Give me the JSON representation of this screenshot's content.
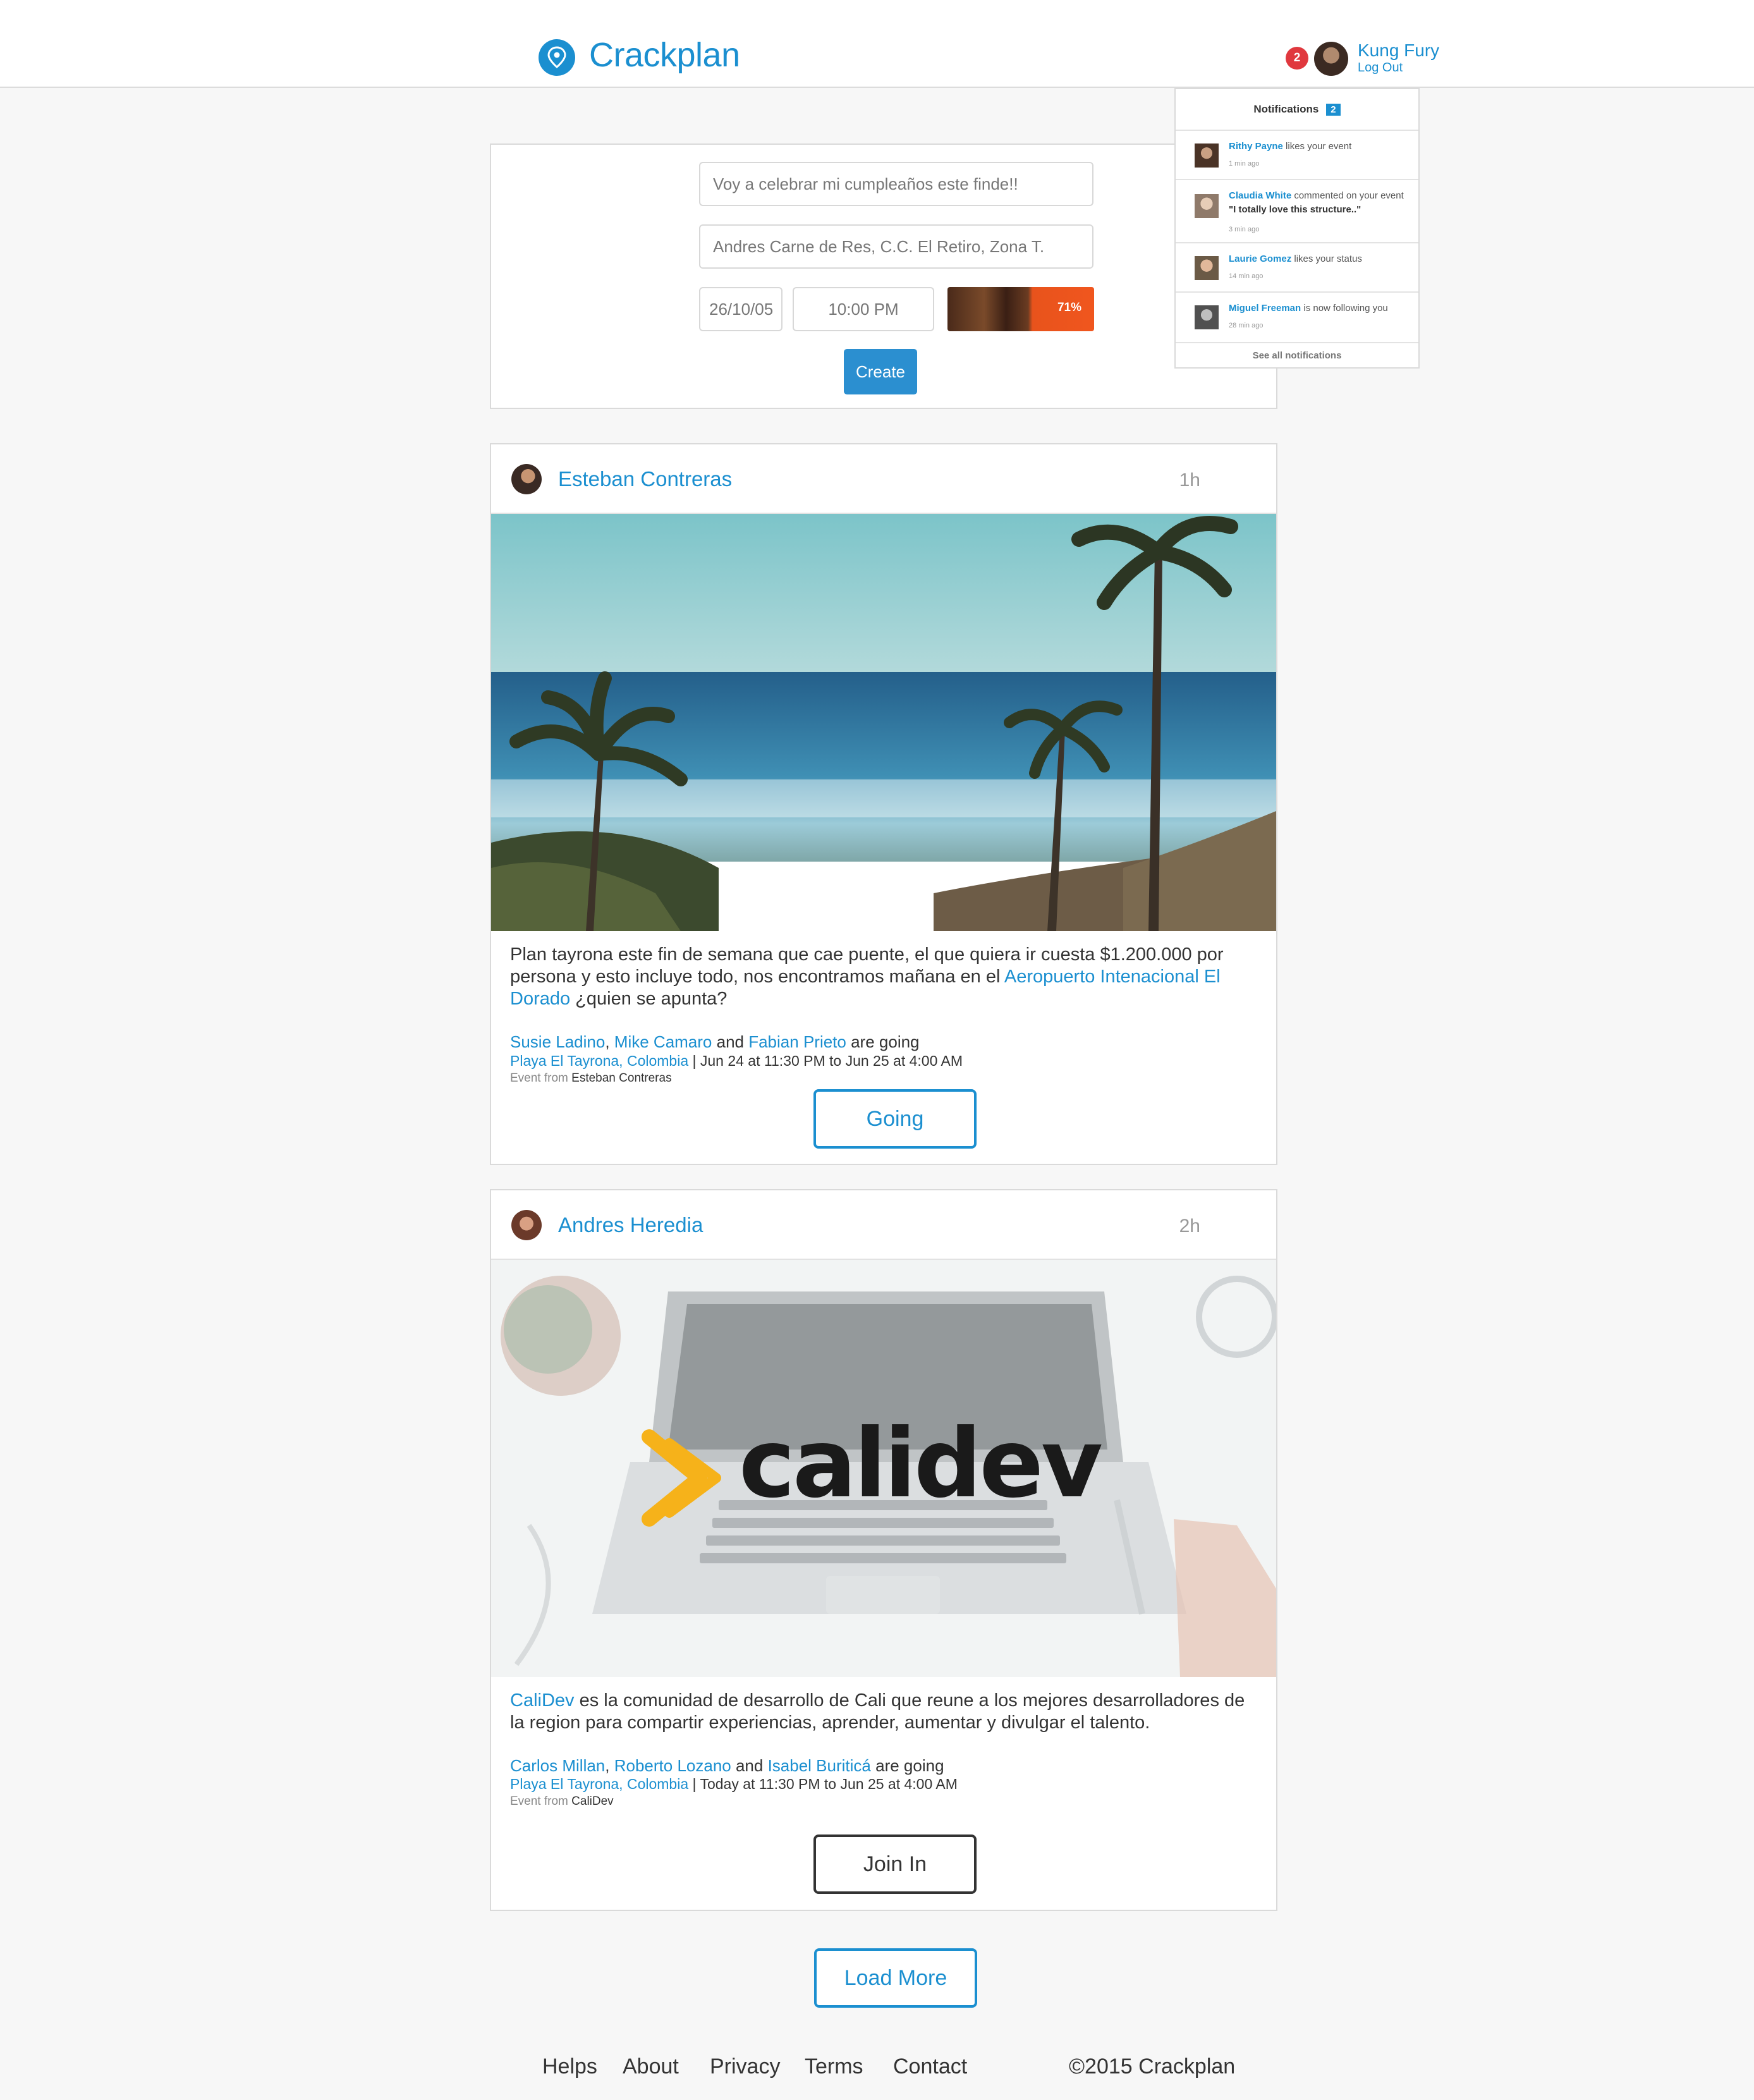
{
  "header": {
    "brand": "Crackplan",
    "notification_count": "2",
    "user_name": "Kung Fury",
    "logout_label": "Log Out"
  },
  "notifications": {
    "title": "Notifications",
    "count": "2",
    "items": [
      {
        "who": "Rithy Payne",
        "text": " likes your event",
        "quote": "",
        "ago": "1 min ago"
      },
      {
        "who": "Claudia White",
        "text": " commented on your event ",
        "quote": "\"I totally love this structure..\"",
        "ago": "3 min ago"
      },
      {
        "who": "Laurie Gomez",
        "text": " likes your status",
        "quote": "",
        "ago": "14 min ago"
      },
      {
        "who": "Miguel Freeman",
        "text": " is now following you",
        "quote": "",
        "ago": "28 min ago"
      }
    ],
    "see_all": "See all notifications"
  },
  "create": {
    "title_value": "Voy a celebrar mi cumpleaños este finde!!",
    "place_value": "Andres Carne de Res, C.C. El Retiro, Zona T.",
    "date_value": "26/10/05",
    "time_value": "10:00 PM",
    "upload_progress": "71%",
    "create_label": "Create"
  },
  "posts": [
    {
      "author": "Esteban Contreras",
      "time": "1h",
      "text_before": "Plan tayrona este fin de semana que cae puente, el que quiera ir cuesta $1.200.000 por persona y esto incluye todo, nos encontramos mañana en el ",
      "text_link": "Aeropuerto Intenacional El Dorado",
      "text_after": " ¿quien se apunta?",
      "going": [
        "Susie Ladino",
        "Mike Camaro",
        "Fabian Prieto"
      ],
      "sep": ", ",
      "and": " and ",
      "going_suffix": " are going",
      "place": "Playa El Tayrona, Colombia",
      "when": " | Jun 24 at 11:30 PM to Jun 25 at 4:00 AM",
      "event_from_label": "Event from ",
      "event_from": "Esteban Contreras",
      "action": "Going"
    },
    {
      "author": "Andres Heredia",
      "time": "2h",
      "image_logo": "calidev",
      "text_link": "CaliDev",
      "text_after": " es la comunidad de desarrollo de Cali que reune a los mejores desarrolladores de la region para compartir experiencias, aprender, aumentar y divulgar el talento.",
      "going": [
        "Carlos Millan",
        "Roberto Lozano",
        "Isabel Buriticá"
      ],
      "sep": ", ",
      "and": " and ",
      "going_suffix": " are going",
      "place": "Playa El Tayrona, Colombia",
      "when": " | Today at 11:30 PM to Jun 25 at 4:00 AM",
      "event_from_label": "Event from ",
      "event_from": "CaliDev",
      "action": "Join In"
    }
  ],
  "load_more": "Load More",
  "footer": {
    "links": [
      "Helps",
      "About",
      "Privacy",
      "Terms",
      "Contact"
    ],
    "copyright": "©2015 Crackplan"
  },
  "colors": {
    "accent": "#1b8fd0",
    "badge": "#e0383e",
    "upload": "#f0561e"
  }
}
